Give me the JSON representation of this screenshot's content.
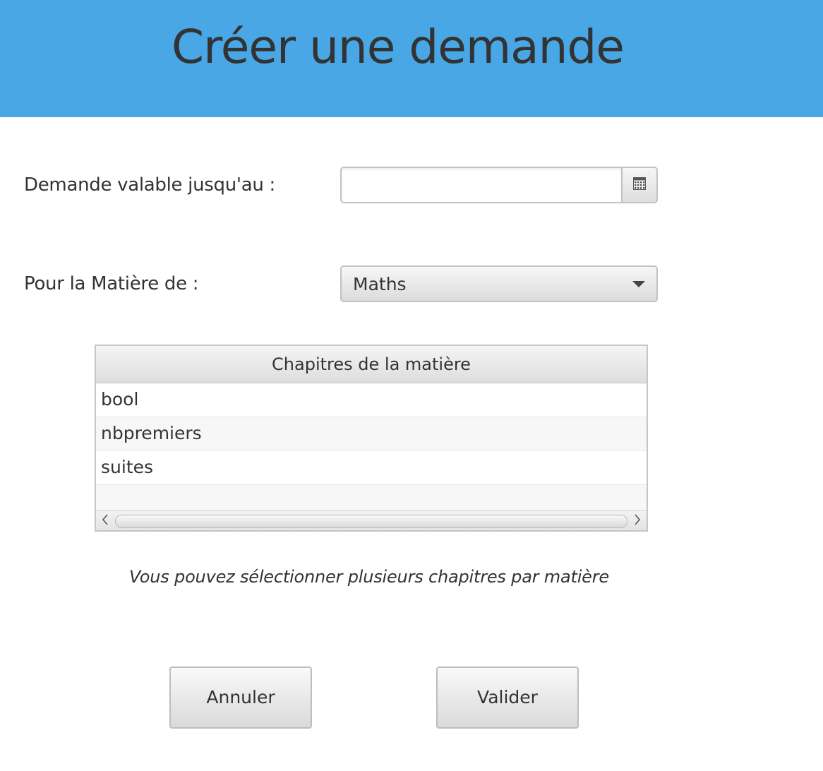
{
  "header": {
    "title": "Créer une demande"
  },
  "form": {
    "date_label": "Demande valable jusqu'au :",
    "date_value": "",
    "subject_label": "Pour la Matière de :",
    "subject_value": "Maths"
  },
  "table": {
    "column_header": "Chapitres de la matière",
    "rows": [
      "bool",
      "nbpremiers",
      "suites"
    ]
  },
  "hint": "Vous pouvez sélectionner plusieurs chapitres par matière",
  "buttons": {
    "cancel": "Annuler",
    "validate": "Valider"
  },
  "colors": {
    "header_bg": "#48a7e4",
    "text": "#333333"
  },
  "icons": [
    "calendar-icon",
    "chevron-down-icon",
    "chevron-left-icon",
    "chevron-right-icon"
  ]
}
